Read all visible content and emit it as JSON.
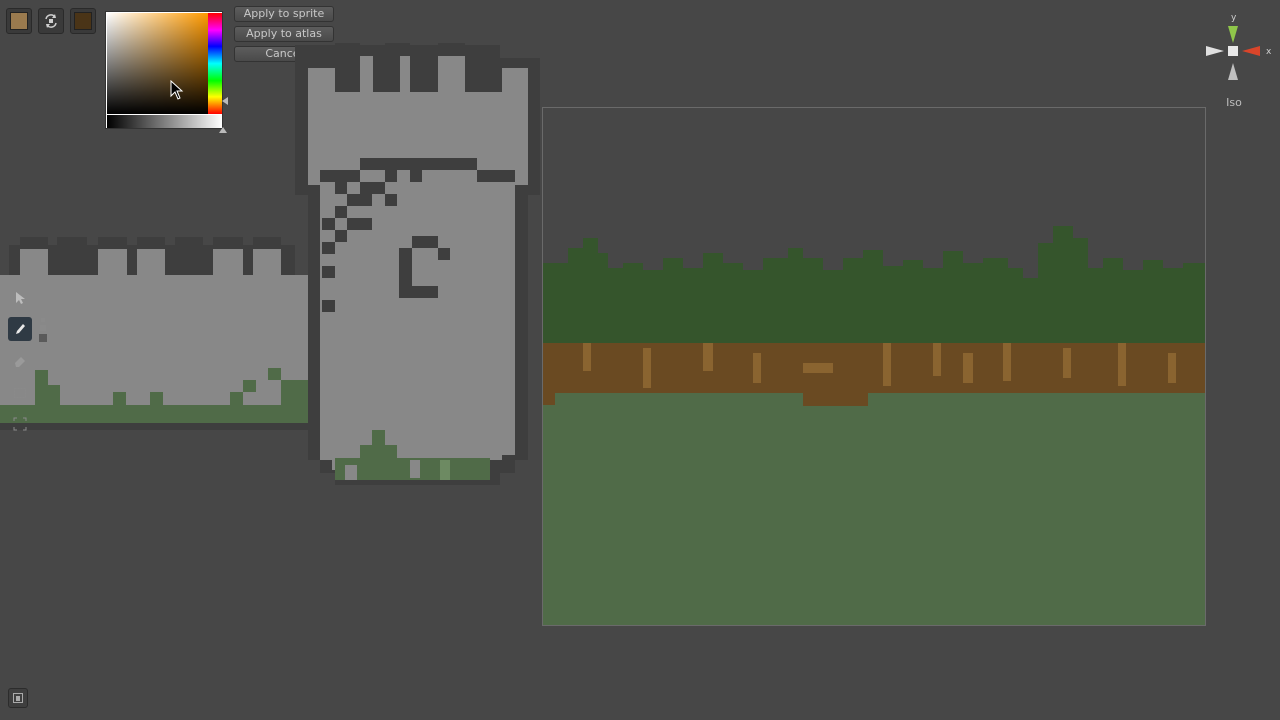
{
  "toolbar": {
    "primary_color": "#9a7a4e",
    "secondary_color": "#4a3417",
    "swap_icon": "swap-icon"
  },
  "color_picker": {
    "hue_color": "#ff9a00"
  },
  "actions": {
    "apply_sprite": "Apply to sprite",
    "apply_atlas": "Apply to atlas",
    "cancel": "Cancel"
  },
  "side_tools": [
    "select-arrow-icon",
    "pencil-icon",
    "eraser-icon",
    "rect-select-icon",
    "fit-icon"
  ],
  "gizmo": {
    "y_label": "y",
    "x_label": "x",
    "mode_label": "Iso"
  },
  "colors": {
    "background": "#474747",
    "tower_gray": "#888888",
    "tower_outline": "#3e3e3e",
    "forest_green": "#35552c",
    "dirt_brown": "#6a4a22",
    "grass_green": "#506b48"
  }
}
